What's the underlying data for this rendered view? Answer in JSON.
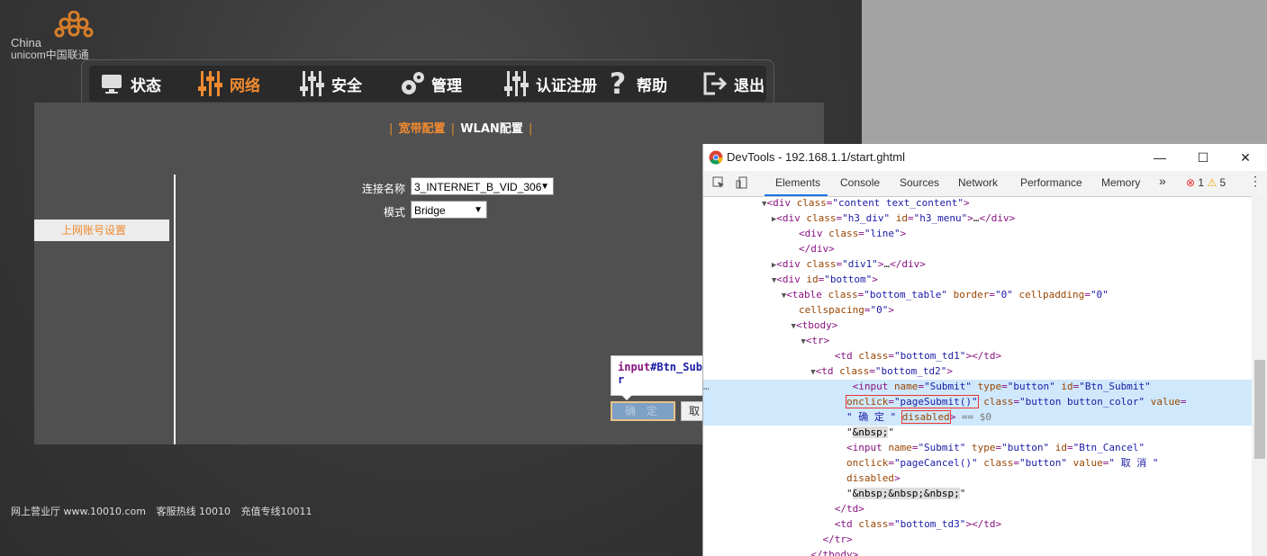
{
  "logo": {
    "line1": "China",
    "line2": "unicom中国联通"
  },
  "nav": [
    {
      "label": "状态",
      "icon": "monitor-icon"
    },
    {
      "label": "网络",
      "icon": "network-sliders-icon",
      "active": true
    },
    {
      "label": "安全",
      "icon": "security-sliders-icon"
    },
    {
      "label": "管理",
      "icon": "gears-icon"
    },
    {
      "label": "认证注册",
      "icon": "register-sliders-icon"
    },
    {
      "label": "帮助",
      "icon": "help-icon"
    },
    {
      "label": "退出",
      "icon": "logout-icon"
    }
  ],
  "submenu": {
    "active": "宽带配置",
    "item": "WLAN配置"
  },
  "sidebar": {
    "item": "上网账号设置"
  },
  "form": {
    "conn_label": "连接名称",
    "conn_value": "3_INTERNET_B_VID_306",
    "mode_label": "模式",
    "mode_value": "Bridge"
  },
  "tooltip": {
    "tag": "input",
    "id": "#Btn_Subm",
    "wrap": "r"
  },
  "buttons": {
    "submit": "确 定",
    "cancel": "取"
  },
  "footer": {
    "site": "网上营业厅 www.10010.com",
    "hotline": "客服热线  10010",
    "recharge": "充值专线10011"
  },
  "devtools": {
    "title": "DevTools - 192.168.1.1/start.ghtml",
    "tabs": [
      "Elements",
      "Console",
      "Sources",
      "Network",
      "Performance",
      "Memory"
    ],
    "more": "»",
    "errors": "1",
    "warnings": "5"
  },
  "colors": {
    "accent": "#f08a30",
    "selection": "#cfe8fc"
  }
}
